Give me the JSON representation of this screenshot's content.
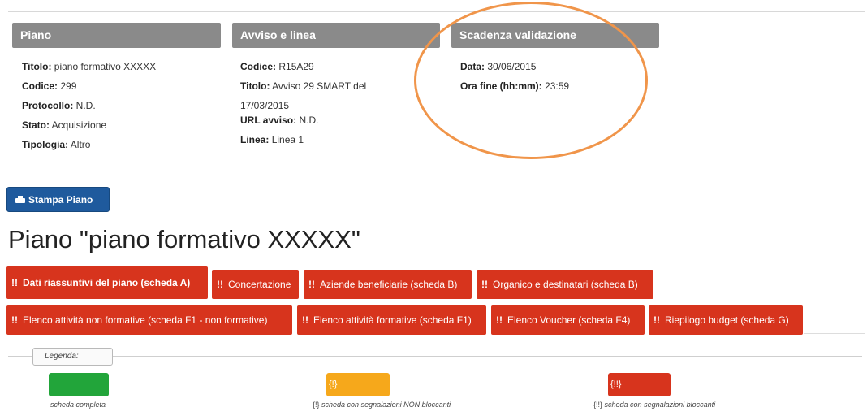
{
  "panels": {
    "piano": {
      "header": "Piano",
      "rows": [
        {
          "label": "Titolo:",
          "value": "piano formativo XXXXX"
        },
        {
          "label": "Codice:",
          "value": "299"
        },
        {
          "label": "Protocollo:",
          "value": "N.D."
        },
        {
          "label": "Stato:",
          "value": "Acquisizione"
        },
        {
          "label": "Tipologia:",
          "value": "Altro"
        }
      ]
    },
    "avviso": {
      "header": "Avviso e linea",
      "codice_label": "Codice:",
      "codice_value": "R15A29",
      "titolo_label": "Titolo:",
      "titolo_value": "Avviso 29 SMART del",
      "titolo_value_2": "17/03/2015",
      "url_label": "URL avviso:",
      "url_value": "N.D.",
      "linea_label": "Linea:",
      "linea_value": "Linea 1"
    },
    "scadenza": {
      "header": "Scadenza validazione",
      "data_label": "Data:",
      "data_value": "30/06/2015",
      "ora_label": "Ora fine (hh:mm):",
      "ora_value": "23:59"
    }
  },
  "print_button": "Stampa Piano",
  "page_title": "Piano \"piano formativo XXXXX\"",
  "tabs_row1": [
    {
      "warn": "!!",
      "label": "Dati riassuntivi del piano (scheda A)"
    },
    {
      "warn": "!!",
      "label": "Concertazione"
    },
    {
      "warn": "!!",
      "label": "Aziende beneficiarie (scheda B)"
    },
    {
      "warn": "!!",
      "label": "Organico e destinatari (scheda B)"
    }
  ],
  "tabs_row2": [
    {
      "warn": "!!",
      "label": "Elenco attività non formative (scheda F1 - non formative)"
    },
    {
      "warn": "!!",
      "label": "Elenco attività formative (scheda F1)"
    },
    {
      "warn": "!!",
      "label": "Elenco Voucher (scheda F4)"
    },
    {
      "warn": "!!",
      "label": "Riepilogo budget (scheda G)"
    }
  ],
  "legend": {
    "title": "Legenda:",
    "items": [
      {
        "swatch_text": "",
        "text": "scheda completa",
        "color": "#22a53a"
      },
      {
        "swatch_text": "{!}",
        "prefix": "{!}",
        "text": "scheda con segnalazioni NON bloccanti",
        "color": "#f6a81b"
      },
      {
        "swatch_text": "{!!}",
        "prefix": "{!!}",
        "text": "scheda con segnalazioni bloccanti",
        "color": "#d7341d"
      }
    ]
  },
  "colors": {
    "header_gray": "#8a8a8a",
    "tab_red": "#d7341d",
    "button_blue": "#1f5a9d",
    "highlight_orange": "#f0954a"
  }
}
